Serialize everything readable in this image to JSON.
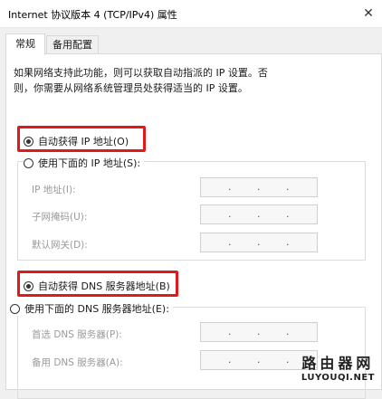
{
  "window": {
    "title": "Internet 协议版本 4 (TCP/IPv4) 属性",
    "close_glyph": "✕"
  },
  "tabs": [
    {
      "label": "常规",
      "active": true
    },
    {
      "label": "备用配置",
      "active": false
    }
  ],
  "description": "如果网络支持此功能，则可以获取自动指派的 IP 设置。否则，你需要从网络系统管理员处获得适当的 IP 设置。",
  "ip": {
    "auto_label": "自动获得 IP 地址(O)",
    "manual_label": "使用下面的 IP 地址(S):",
    "fields": [
      {
        "label": "IP 地址(I):",
        "value": ". . ."
      },
      {
        "label": "子网掩码(U):",
        "value": ". . ."
      },
      {
        "label": "默认网关(D):",
        "value": ". . ."
      }
    ]
  },
  "dns": {
    "auto_label": "自动获得 DNS 服务器地址(B)",
    "manual_label": "使用下面的 DNS 服务器地址(E):",
    "fields": [
      {
        "label": "首选 DNS 服务器(P):",
        "value": ". . ."
      },
      {
        "label": "备用 DNS 服务器(A):",
        "value": ". . ."
      }
    ]
  },
  "watermark": {
    "cn": "路由器网",
    "en": "LUYOUQI.NET"
  },
  "colors": {
    "highlight": "#e01a1a",
    "panel_bg": "#ffffff",
    "window_bg": "#f0f0f0"
  }
}
